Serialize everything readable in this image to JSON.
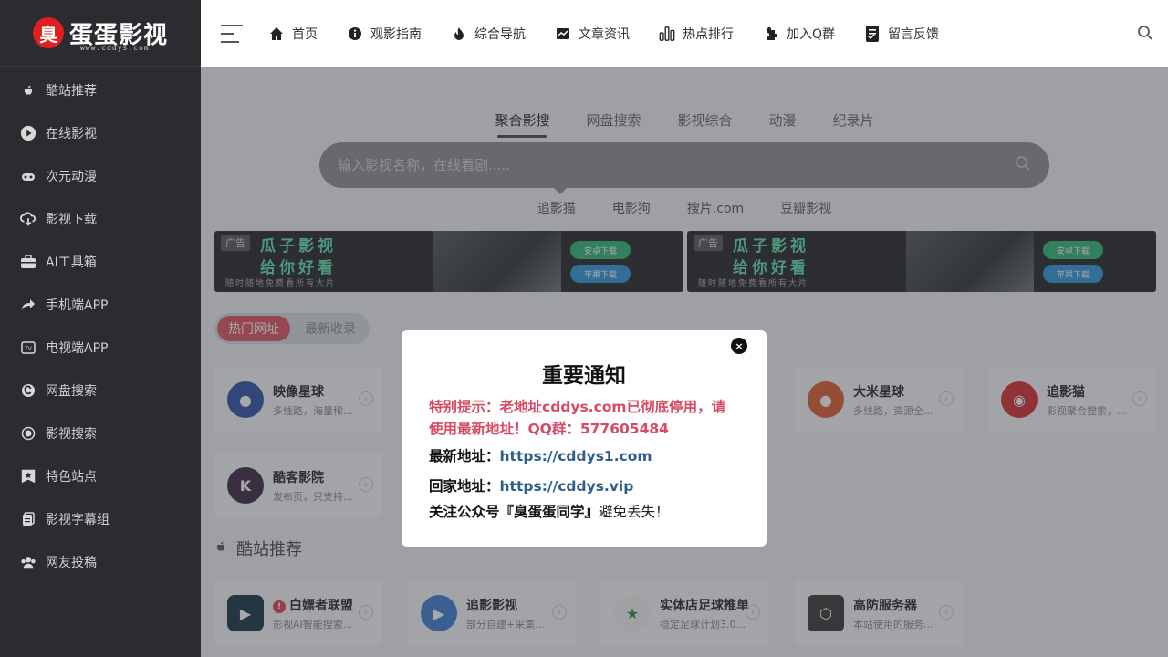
{
  "brand": {
    "mark": "臭",
    "name": "蛋蛋影视",
    "domain": "www.cddys.com"
  },
  "sidebar": {
    "items": [
      {
        "label": "酷站推荐",
        "icon": "apple-icon"
      },
      {
        "label": "在线影视",
        "icon": "play-circle-icon"
      },
      {
        "label": "次元动漫",
        "icon": "gamepad-icon"
      },
      {
        "label": "影视下载",
        "icon": "cloud-download-icon"
      },
      {
        "label": "AI工具箱",
        "icon": "toolbox-icon"
      },
      {
        "label": "手机端APP",
        "icon": "share-arrow-icon"
      },
      {
        "label": "电视端APP",
        "icon": "tv-icon"
      },
      {
        "label": "网盘搜索",
        "icon": "c-circle-icon"
      },
      {
        "label": "影视搜索",
        "icon": "record-icon"
      },
      {
        "label": "特色站点",
        "icon": "bookmark-star-icon"
      },
      {
        "label": "影视字幕组",
        "icon": "copy-icon"
      },
      {
        "label": "网友投稿",
        "icon": "users-icon"
      }
    ]
  },
  "topnav": {
    "items": [
      {
        "label": "首页",
        "icon": "home-icon"
      },
      {
        "label": "观影指南",
        "icon": "info-icon"
      },
      {
        "label": "综合导航",
        "icon": "fire-icon"
      },
      {
        "label": "文章资讯",
        "icon": "chart-line-icon"
      },
      {
        "label": "热点排行",
        "icon": "bar-chart-icon"
      },
      {
        "label": "加入Q群",
        "icon": "puzzle-icon"
      },
      {
        "label": "留言反馈",
        "icon": "document-icon"
      }
    ]
  },
  "search": {
    "tabs": [
      "聚合影搜",
      "网盘搜索",
      "影视综合",
      "动漫",
      "纪录片"
    ],
    "active_tab": "聚合影搜",
    "placeholder": "输入影视名称，在线看剧.....",
    "sub_links": [
      "追影猫",
      "电影狗",
      "搜片.com",
      "豆瓣影视"
    ]
  },
  "banners": [
    {
      "tag": "广告",
      "title1": "瓜子影视",
      "title2": "给你好看",
      "tagline": "随时随地免费看所有大片",
      "btn_android": "安卓下载",
      "btn_ios": "苹果下载"
    },
    {
      "tag": "广告",
      "title1": "瓜子影视",
      "title2": "给你好看",
      "tagline": "随时随地免费看所有大片",
      "btn_android": "安卓下载",
      "btn_ios": "苹果下载"
    }
  ],
  "chips": [
    "热门网址",
    "最新收录"
  ],
  "hot_cards": [
    {
      "name": "映像星球",
      "desc": "多线路，海量稀..."
    },
    {
      "name": "大米星球",
      "desc": "多线路，资源全..."
    },
    {
      "name": "追影猫",
      "desc": "影视聚合搜索，..."
    },
    {
      "name": "酷客影院",
      "desc": "发布页，只支持..."
    }
  ],
  "section": {
    "title": "酷站推荐"
  },
  "rec_cards": [
    {
      "name": "白嫖者联盟",
      "desc": "影视AI智能搜索...",
      "hot": "!"
    },
    {
      "name": "追影影视",
      "desc": "部分自建+采集..."
    },
    {
      "name": "实体店足球推单",
      "desc": "稳定足球计划3.0..."
    },
    {
      "name": "高防服务器",
      "desc": "本站使用的服务..."
    }
  ],
  "modal": {
    "title": "重要通知",
    "alert": "特别提示：老地址cddys.com已彻底停用，请使用最新地址！QQ群：577605484",
    "latest_label": "最新地址：",
    "latest_url": "https://cddys1.com",
    "home_label": "回家地址：",
    "home_url": "https://cddys.vip",
    "follow_bold": "关注公众号『臭蛋蛋同学』",
    "follow_rest": "避免丢失！",
    "close": "×"
  },
  "colors": {
    "sidebar_bg": "#2a2c30",
    "accent_red": "#e05060",
    "alert_text": "#d84a63",
    "link_blue": "#2c5f8c"
  }
}
